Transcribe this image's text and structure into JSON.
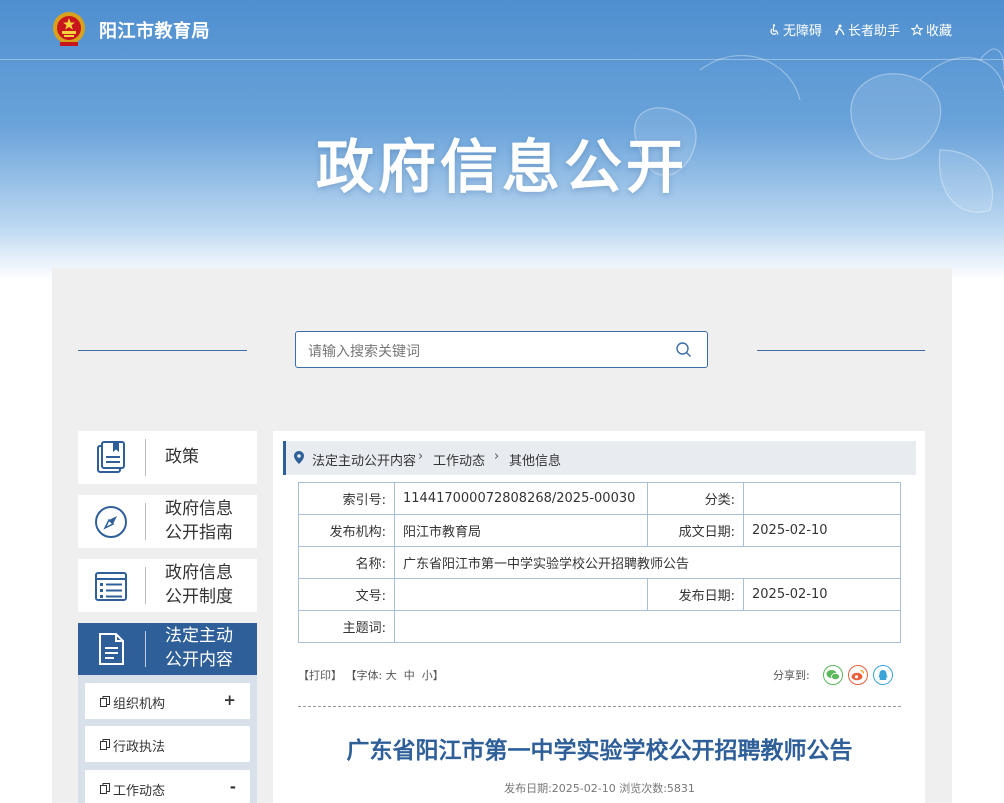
{
  "header": {
    "site_title": "阳江市教育局",
    "tools": [
      {
        "icon": "wheelchair-icon",
        "label": "无障碍"
      },
      {
        "icon": "elder-assist-icon",
        "label": "长者助手"
      },
      {
        "icon": "star-icon",
        "label": "收藏"
      }
    ],
    "hero_title": "政府信息公开"
  },
  "search": {
    "placeholder": "请输入搜索关键词"
  },
  "sidebar": {
    "items": [
      {
        "label": "政策",
        "icon": "document-icon"
      },
      {
        "label": "政府信息公开指南",
        "line1": "政府信息",
        "line2": "公开指南",
        "icon": "compass-icon"
      },
      {
        "label": "政府信息公开制度",
        "line1": "政府信息",
        "line2": "公开制度",
        "icon": "list-icon"
      },
      {
        "label": "法定主动公开内容",
        "line1": "法定主动",
        "line2": "公开内容",
        "icon": "file-icon",
        "active": true
      }
    ],
    "sub_items": [
      {
        "label": "组织机构",
        "toggle": "+"
      },
      {
        "label": "行政执法",
        "toggle": ""
      },
      {
        "label": "工作动态",
        "toggle": "-"
      }
    ]
  },
  "breadcrumb": [
    "法定主动公开内容",
    "工作动态",
    "其他信息"
  ],
  "meta": {
    "index_label": "索引号:",
    "index_value": "114417000072808268/2025-00030",
    "category_label": "分类:",
    "category_value": "",
    "org_label": "发布机构:",
    "org_value": "阳江市教育局",
    "created_label": "成文日期:",
    "created_value": "2025-02-10",
    "name_label": "名称:",
    "name_value": "广东省阳江市第一中学实验学校公开招聘教师公告",
    "docno_label": "文号:",
    "docno_value": "",
    "published_label": "发布日期:",
    "published_value": "2025-02-10",
    "subject_label": "主题词:",
    "subject_value": ""
  },
  "article_tools": {
    "print": "【打印】",
    "font_label": "【字体:",
    "font_large": "大",
    "font_medium": "中",
    "font_small": "小",
    "font_end": "】",
    "share_label": "分享到:",
    "share": [
      {
        "icon": "wechat-icon",
        "color": "#5cb85c"
      },
      {
        "icon": "weibo-icon",
        "color": "#e8613c"
      },
      {
        "icon": "qq-icon",
        "color": "#3aa3d8"
      }
    ]
  },
  "article": {
    "title": "广东省阳江市第一中学实验学校公开招聘教师公告",
    "meta_line": "发布日期:2025-02-10  浏览次数:5831"
  },
  "colors": {
    "primary": "#2e5f99",
    "border": "#a9bfd8",
    "panel": "#efefef"
  }
}
